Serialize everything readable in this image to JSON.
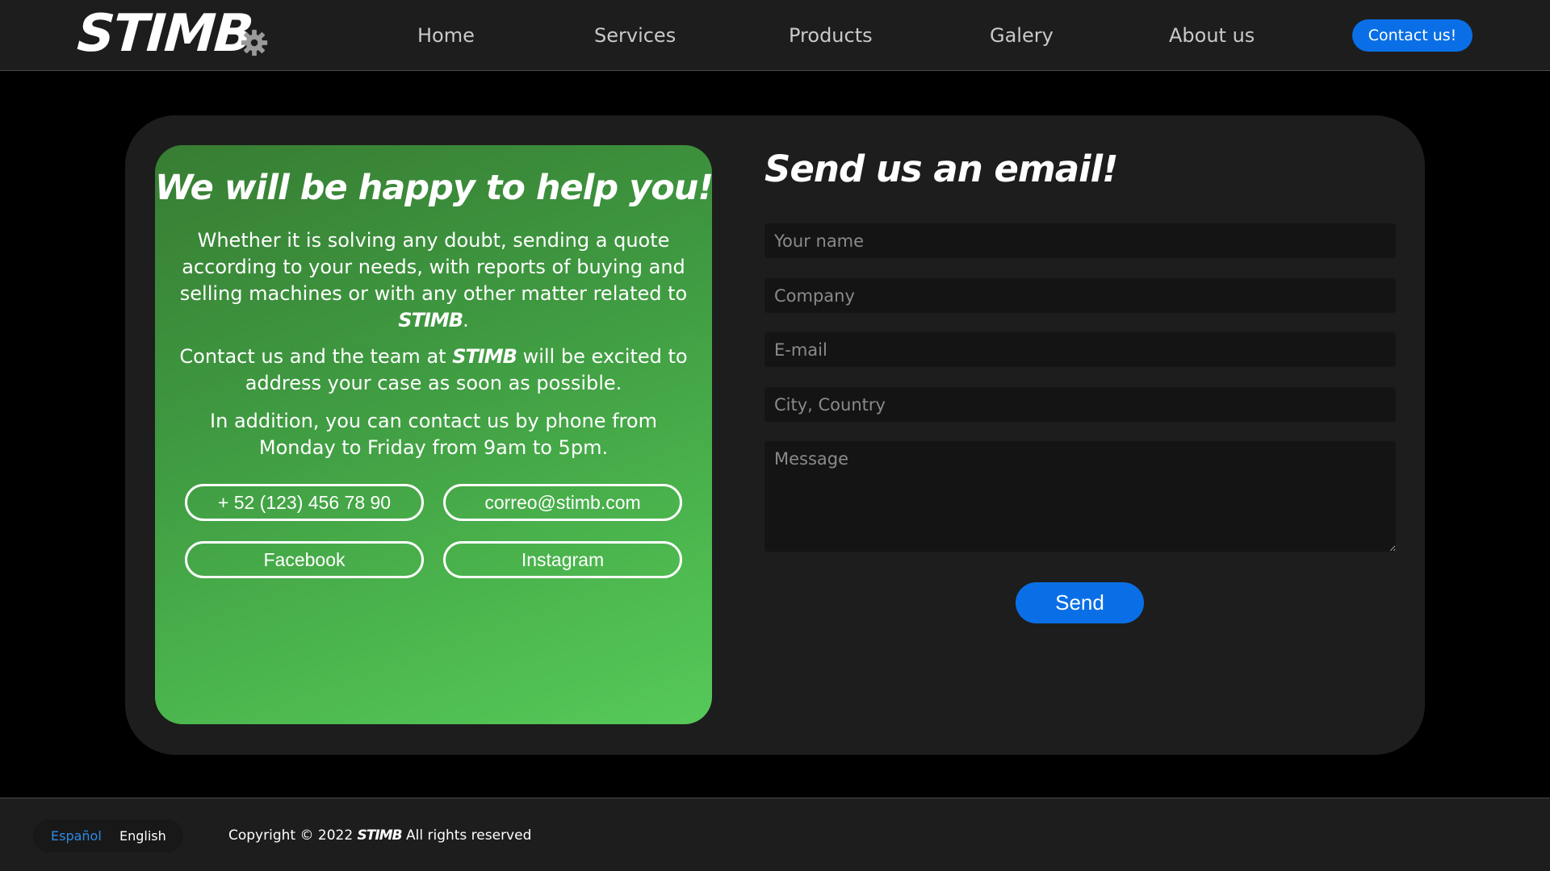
{
  "header": {
    "logo_text": "STIMB",
    "nav": [
      {
        "label": "Home"
      },
      {
        "label": "Services"
      },
      {
        "label": "Products"
      },
      {
        "label": "Galery"
      },
      {
        "label": "About us"
      }
    ],
    "contact_button": "Contact us!"
  },
  "help": {
    "title": "We will be happy to help you!",
    "p1_before": "Whether it is solving any doubt, sending a quote according to your needs, with reports of buying and selling machines or with any other matter related to ",
    "p1_brand": "STIMB",
    "p1_after": ".",
    "p2_before": "Contact us and the team at ",
    "p2_brand": "STIMB",
    "p2_after": " will be excited to address your case as soon as possible.",
    "p3": "In addition, you can contact us by phone from Monday to Friday from 9am to 5pm.",
    "phone": "+ 52 (123) 456 78 90",
    "email": "correo@stimb.com",
    "facebook": "Facebook",
    "instagram": "Instagram"
  },
  "form": {
    "title": "Send us an email!",
    "name_placeholder": "Your name",
    "company_placeholder": "Company",
    "email_placeholder": "E-mail",
    "city_placeholder": "City, Country",
    "message_placeholder": "Message",
    "send_label": "Send"
  },
  "footer": {
    "lang_es": "Español",
    "lang_en": "English",
    "copyright_before": "Copyright © 2022 ",
    "copyright_brand": "STIMB",
    "copyright_after": " All rights reserved"
  },
  "colors": {
    "accent": "#0a6fe6",
    "panel_green": "#4cb74e",
    "surface": "#1d1d1d",
    "active_lang": "#2f8be6"
  },
  "icons": {
    "logo_gear": "gear-icon"
  }
}
